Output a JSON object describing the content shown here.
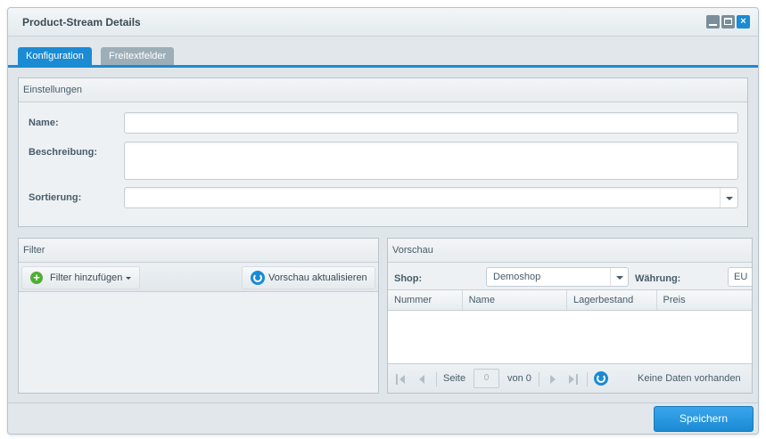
{
  "window": {
    "title": "Product-Stream Details"
  },
  "tabs": [
    {
      "label": "Konfiguration",
      "active": true
    },
    {
      "label": "Freitextfelder",
      "active": false
    }
  ],
  "settings": {
    "heading": "Einstellungen",
    "name_label": "Name:",
    "name_value": "",
    "description_label": "Beschreibung:",
    "description_value": "",
    "sort_label": "Sortierung:",
    "sort_value": ""
  },
  "filter": {
    "heading": "Filter",
    "add_filter_label": "Filter hinzufügen",
    "refresh_preview_label": "Vorschau aktualisieren"
  },
  "preview": {
    "heading": "Vorschau",
    "shop_label": "Shop:",
    "shop_value": "Demoshop",
    "currency_label": "Währung:",
    "currency_value": "EU",
    "columns": [
      "Nummer",
      "Name",
      "Lagerbestand",
      "Preis"
    ],
    "pager": {
      "page_label": "Seite",
      "page_value": "0",
      "of_label": "von 0",
      "empty_text": "Keine Daten vorhanden"
    }
  },
  "footer": {
    "save_label": "Speichern"
  },
  "colors": {
    "accent": "#1b8bd3",
    "add_icon": "#4fae35"
  }
}
